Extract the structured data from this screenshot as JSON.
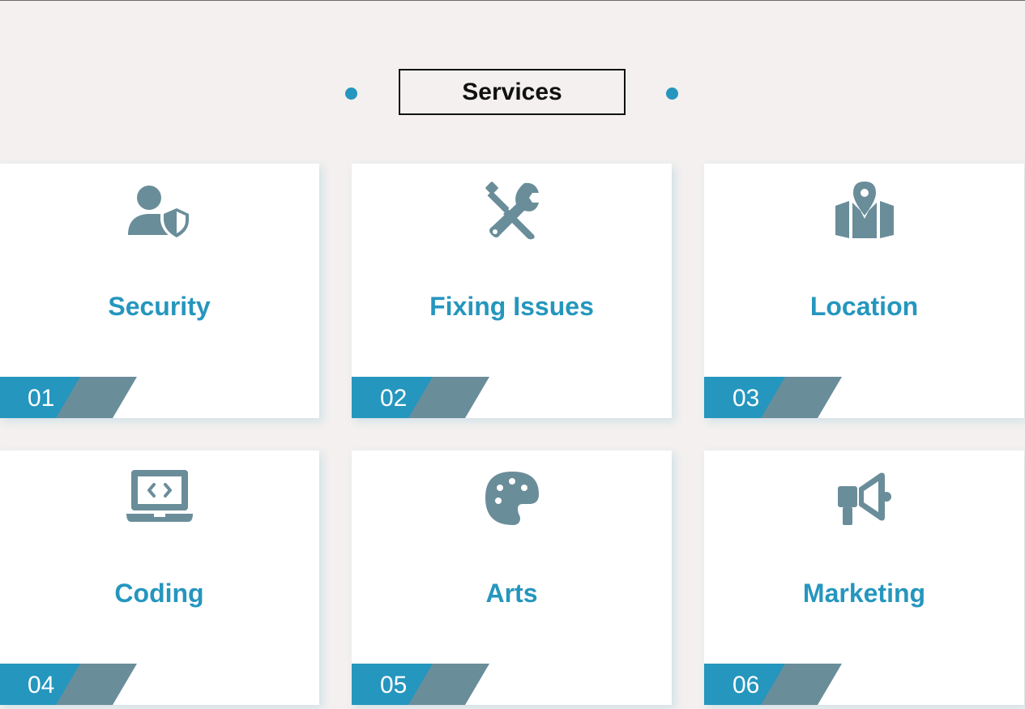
{
  "section": {
    "title": "Services"
  },
  "colors": {
    "accent": "#2596be",
    "slate": "#6a8d9a",
    "background": "#f3f0ef",
    "card": "#ffffff"
  },
  "services": [
    {
      "number": "01",
      "title": "Security",
      "icon": "user-shield-icon"
    },
    {
      "number": "02",
      "title": "Fixing Issues",
      "icon": "screwdriver-wrench-icon"
    },
    {
      "number": "03",
      "title": "Location",
      "icon": "map-location-icon"
    },
    {
      "number": "04",
      "title": "Coding",
      "icon": "laptop-code-icon"
    },
    {
      "number": "05",
      "title": "Arts",
      "icon": "palette-icon"
    },
    {
      "number": "06",
      "title": "Marketing",
      "icon": "bullhorn-icon"
    }
  ]
}
